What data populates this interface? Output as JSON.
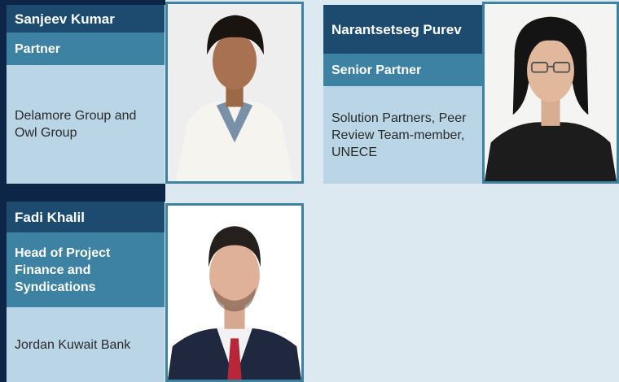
{
  "people": [
    {
      "name": "Sanjeev Kumar",
      "role": "Partner",
      "organization": "Delamore Group and Owl Group",
      "photo_icon": "portrait-photo"
    },
    {
      "name": "Narantsetseg Purev",
      "role": "Senior Partner",
      "organization": "Solution Partners, Peer Review Team-member, UNECE",
      "photo_icon": "portrait-photo"
    },
    {
      "name": "Fadi Khalil",
      "role": "Head of Project Finance and Syndications",
      "organization": "Jordan Kuwait Bank",
      "photo_icon": "portrait-photo"
    }
  ],
  "colors": {
    "name_bg": "#1d4b6f",
    "role_bg": "#3d82a2",
    "org_bg": "#bad6e6",
    "navy_strip": "#0d2546",
    "page_bg": "#dce9f1"
  }
}
